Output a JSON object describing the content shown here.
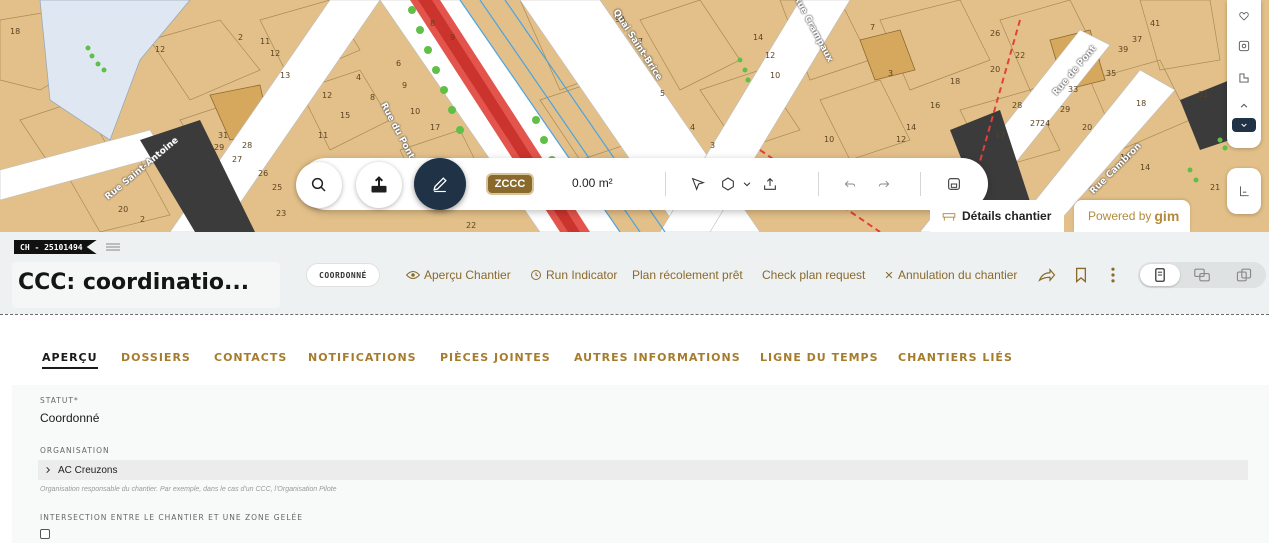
{
  "map": {
    "street_labels": {
      "quai_sainte_brice": "Quai Saint-Brice",
      "rue_pont": "Rue de Pont",
      "rue_cambron": "Rue Cambron",
      "rue_crampaux": "Rue Crampaux",
      "rue_dupont": "Rue du Pont",
      "rue_saint_antoine": "Rue Saint-Antoine"
    },
    "parcel_numbers": [
      "18",
      "12",
      "2",
      "11",
      "12",
      "13",
      "8",
      "9",
      "9A",
      "7",
      "14",
      "12",
      "8",
      "10",
      "7",
      "26",
      "22",
      "20",
      "37",
      "39",
      "41",
      "35",
      "31",
      "28",
      "24",
      "19",
      "12",
      "15",
      "17",
      "14",
      "16",
      "18",
      "27",
      "29",
      "33",
      "31",
      "25",
      "23",
      "22",
      "20",
      "24",
      "21",
      "16",
      "18",
      "27",
      "26",
      "25",
      "23",
      "31",
      "29",
      "28"
    ]
  },
  "toolbar": {
    "zone_chip": "ZCCC",
    "area_readout": "0.00 m²"
  },
  "panel_tabs": {
    "details": "Détails chantier",
    "powered_by_prefix": "Powered by",
    "powered_by_brand": "gim"
  },
  "header": {
    "ch_id": "CH - 25101494",
    "title": "CCC: coordinatio...",
    "status_chip": "COORDONNÉ",
    "actions": {
      "apercu": "Aperçu Chantier",
      "run_indicator": "Run Indicator",
      "plan_recolement": "Plan récolement prêt",
      "check_plan": "Check plan request",
      "annulation": "Annulation du chantier"
    }
  },
  "tabs": [
    "APERÇU",
    "DOSSIERS",
    "CONTACTS",
    "NOTIFICATIONS",
    "PIÈCES JOINTES",
    "AUTRES INFORMATIONS",
    "LIGNE DU TEMPS",
    "CHANTIERS LIÉS"
  ],
  "fields": {
    "statut_label": "STATUT*",
    "statut_value": "Coordonné",
    "organisation_label": "ORGANISATION",
    "organisation_value": "AC Creuzons",
    "organisation_hint": "Organisation responsable du chantier. Par exemple, dans le cas d'un CCC, l'Organisation Pilote",
    "intersection_label": "INTERSECTION ENTRE LE CHANTIER ET UNE ZONE GELÉE"
  },
  "colors": {
    "accent_gold": "#a67c2c",
    "dark_navy": "#1f3246",
    "map_parcel": "#e6c48c",
    "map_road": "#ffffff",
    "map_highlight_red": "#e0413a"
  }
}
